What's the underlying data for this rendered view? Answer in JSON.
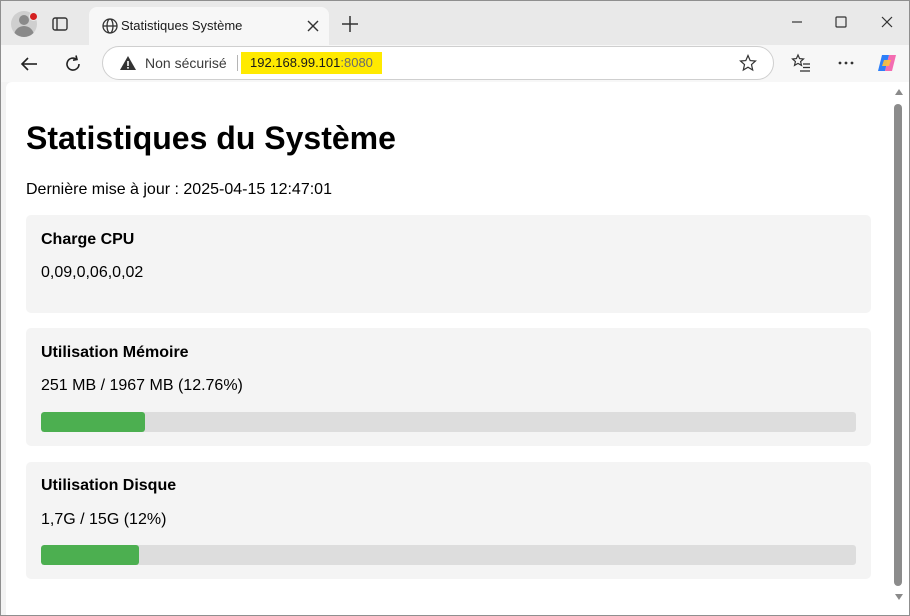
{
  "browser": {
    "tab_title": "Statistiques Système",
    "security_label": "Non sécurisé",
    "url_host": "192.168.99.101",
    "url_port": ":8080",
    "icons": [
      "profile-icon",
      "tab-actions-icon",
      "globe-icon",
      "close-icon",
      "new-tab-icon",
      "minimize-icon",
      "maximize-icon",
      "window-close-icon",
      "back-icon",
      "reload-icon",
      "warning-icon",
      "favorite-star-icon",
      "favorites-list-icon",
      "more-icon",
      "copilot-icon"
    ]
  },
  "page": {
    "title": "Statistiques du Système",
    "last_update": "Dernière mise à jour : 2025-04-15 12:47:01",
    "cpu": {
      "title": "Charge CPU",
      "value": "0,09,0,06,0,02"
    },
    "memory": {
      "title": "Utilisation Mémoire",
      "value": "251 MB / 1967 MB (12.76%)",
      "percent": 12.76
    },
    "disk": {
      "title": "Utilisation Disque",
      "value": "1,7G / 15G (12%)",
      "percent": 12
    }
  },
  "colors": {
    "progress_fill": "#4caf50",
    "progress_track": "#dddddd",
    "url_highlight": "#ffea00",
    "notification_dot": "#d42020"
  }
}
